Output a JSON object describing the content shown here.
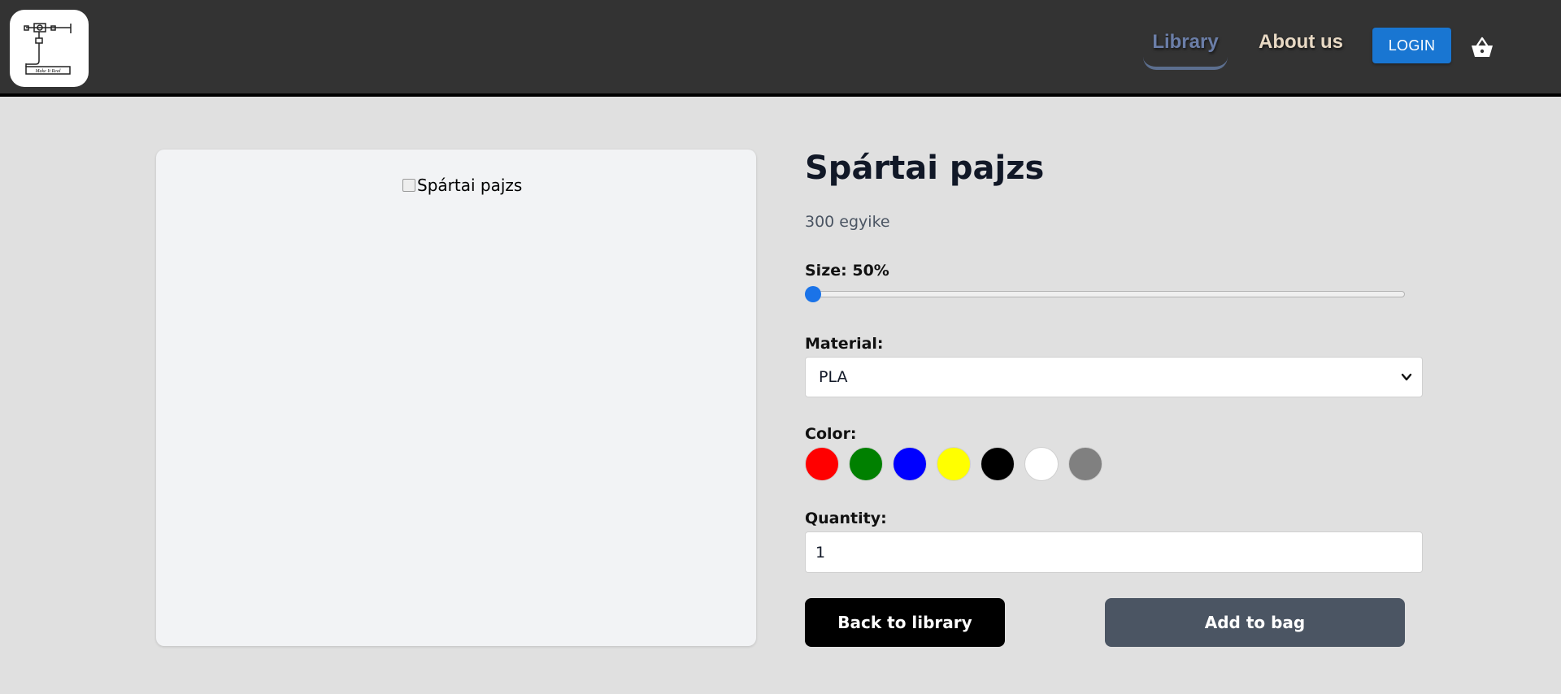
{
  "header": {
    "logo_text": "Make It Real",
    "nav": {
      "library": "Library",
      "about": "About us"
    },
    "login_label": "LOGIN"
  },
  "product": {
    "image_alt": "Spártai pajzs",
    "title": "Spártai pajzs",
    "subtitle": "300 egyike",
    "size_label": "Size: 50%",
    "size_slider_value": 0,
    "material_label": "Material:",
    "material_value": "PLA",
    "color_label": "Color:",
    "colors": [
      "#ff0000",
      "#008000",
      "#0000ff",
      "#ffff00",
      "#000000",
      "#ffffff",
      "#808080"
    ],
    "quantity_label": "Quantity:",
    "quantity_value": "1"
  },
  "actions": {
    "back": "Back to library",
    "add": "Add to bag"
  },
  "theme": {
    "header_bg": "#333333",
    "login_bg": "#1976d2",
    "add_btn_bg": "#4b5563"
  }
}
